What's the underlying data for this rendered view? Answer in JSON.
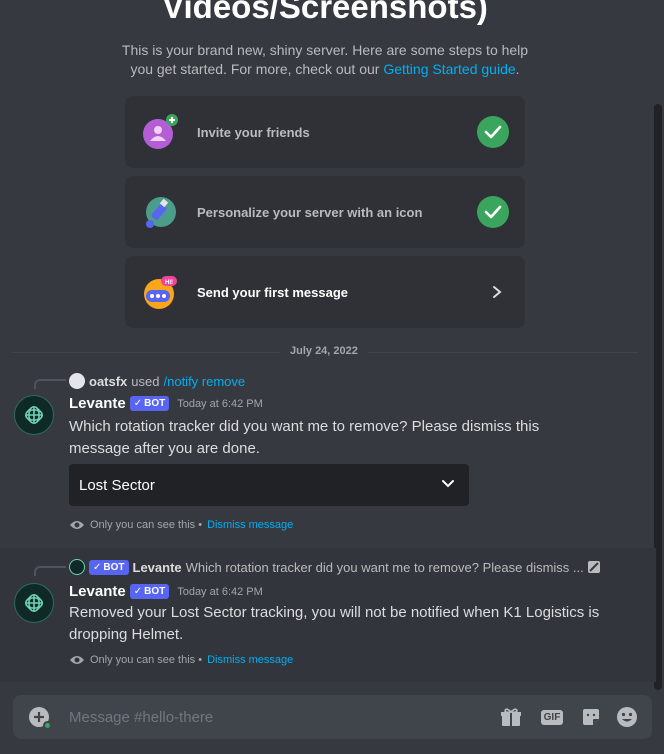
{
  "hero": {
    "title": "Videos/Screenshots)",
    "subtitle": "This is your brand new, shiny server. Here are some steps to help you get started. For more, check out our ",
    "link": "Getting Started guide",
    "suffix": "."
  },
  "cards": [
    {
      "label": "Invite your friends",
      "state": "done"
    },
    {
      "label": "Personalize your server with an icon",
      "state": "done"
    },
    {
      "label": "Send your first message",
      "state": "todo",
      "badge": "HI!"
    }
  ],
  "date_divider": "July 24, 2022",
  "message1": {
    "reply_user": "oatsfx",
    "reply_used": "used",
    "reply_command": "/notify remove",
    "author": "Levante",
    "bot_tag": "BOT",
    "timestamp": "Today at 6:42 PM",
    "text": "Which rotation tracker did you want me to remove? Please dismiss this message after you are done.",
    "select_value": "Lost Sector",
    "ephemeral_note": "Only you can see this •",
    "dismiss": "Dismiss message"
  },
  "message2": {
    "reply_bot_tag": "BOT",
    "reply_author": "Levante",
    "reply_text": "Which rotation tracker did you want me to remove? Please dismiss ...",
    "author": "Levante",
    "bot_tag": "BOT",
    "timestamp": "Today at 6:42 PM",
    "text": "Removed your Lost Sector tracking, you will not be notified when K1 Logistics is dropping Helmet.",
    "ephemeral_note": "Only you can see this •",
    "dismiss": "Dismiss message"
  },
  "composer": {
    "placeholder": "Message #hello-there",
    "gif_label": "GIF"
  },
  "colors": {
    "background": "#36393f",
    "card": "#2f3136",
    "accent_link": "#00aff4",
    "bot_tag": "#5865f2",
    "check_green": "#3ba55d"
  }
}
